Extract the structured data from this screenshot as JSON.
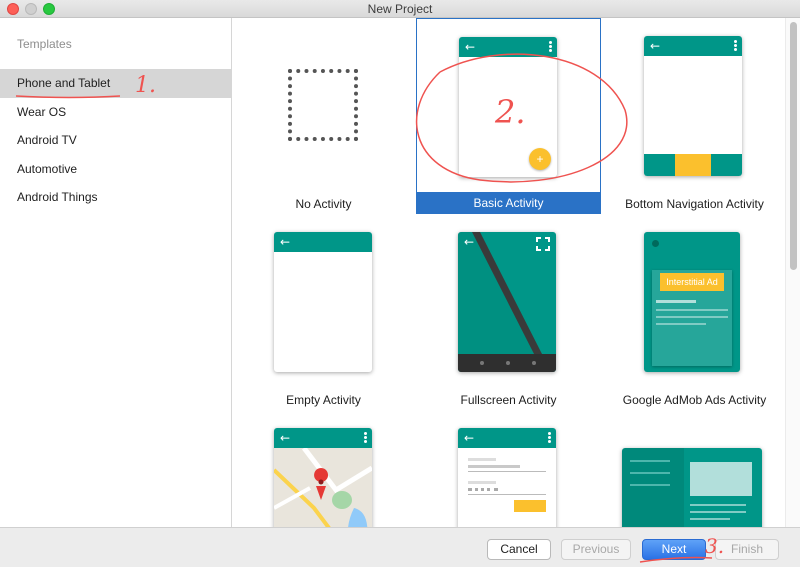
{
  "window": {
    "title": "New Project"
  },
  "sidebar": {
    "header": "Templates",
    "items": [
      {
        "label": "Phone and Tablet",
        "selected": true
      },
      {
        "label": "Wear OS",
        "selected": false
      },
      {
        "label": "Android TV",
        "selected": false
      },
      {
        "label": "Automotive",
        "selected": false
      },
      {
        "label": "Android Things",
        "selected": false
      }
    ]
  },
  "templates": [
    {
      "label": "No Activity",
      "selected": false
    },
    {
      "label": "Basic Activity",
      "selected": true
    },
    {
      "label": "Bottom Navigation Activity",
      "selected": false
    },
    {
      "label": "Empty Activity",
      "selected": false
    },
    {
      "label": "Fullscreen Activity",
      "selected": false
    },
    {
      "label": "Google AdMob Ads Activity",
      "selected": false
    }
  ],
  "admob_preview": {
    "badge": "Interstitial Ad"
  },
  "footer": {
    "cancel_label": "Cancel",
    "previous_label": "Previous",
    "next_label": "Next",
    "finish_label": "Finish"
  },
  "annotations": {
    "step1": "1.",
    "step2": "2.",
    "step3": "3."
  },
  "colors": {
    "accent": "#009688",
    "fab": "#fbc02d",
    "selection": "#2a72c6",
    "annotation": "#ef5350"
  }
}
